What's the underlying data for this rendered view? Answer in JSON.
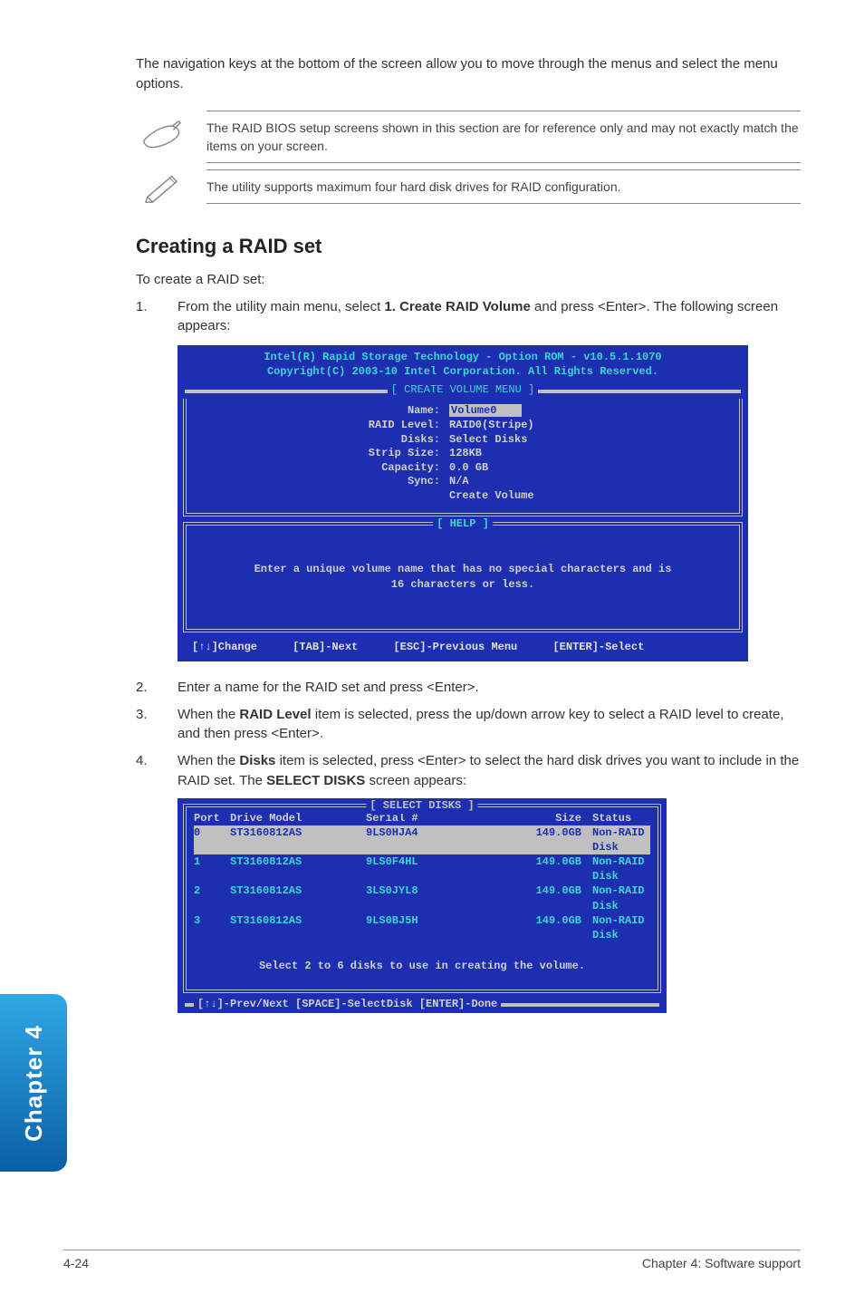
{
  "intro": "The navigation keys at the bottom of the screen allow you to move through the menus and select the menu options.",
  "note1": "The RAID BIOS setup screens shown in this section are for reference only and may not exactly match the items on your screen.",
  "note2": "The utility supports maximum four hard disk drives for RAID configuration.",
  "heading": "Creating a RAID set",
  "sub": "To create a RAID set:",
  "steps": {
    "s1a": "From the utility main menu, select ",
    "s1b": "1. Create RAID Volume",
    "s1c": " and press <Enter>. The following screen appears:",
    "s2": "Enter a name for the RAID set and press <Enter>.",
    "s3a": "When the ",
    "s3b": "RAID Level",
    "s3c": " item is selected, press the up/down arrow key to select a RAID level to create, and then press <Enter>.",
    "s4a": "When the ",
    "s4b": "Disks",
    "s4c": " item is selected, press <Enter> to select the hard disk drives you want to include in the RAID set. The ",
    "s4d": "SELECT DISKS",
    "s4e": " screen appears:"
  },
  "bios": {
    "hdr1": "Intel(R) Rapid Storage Technology - Option ROM - v10.5.1.1070",
    "hdr2": "Copyright(C) 2003-10 Intel Corporation.  All Rights Reserved.",
    "menu_title": "[ CREATE VOLUME MENU ]",
    "fields": {
      "name_l": "Name:",
      "name_v": "Volume0",
      "raid_l": "RAID Level:",
      "raid_v": "RAID0(Stripe)",
      "disks_l": "Disks:",
      "disks_v": "Select Disks",
      "strip_l": "Strip Size:",
      "strip_v": "128KB",
      "cap_l": "Capacity:",
      "cap_v": "0.0   GB",
      "sync_l": "Sync:",
      "sync_v": "N/A",
      "create_v": "Create Volume"
    },
    "help_title": "[ HELP ]",
    "help_l1": "Enter a unique volume name that has no special characters and is",
    "help_l2": "16 characters or less.",
    "nav": {
      "a": "[↑↓]Change",
      "b": "[TAB]-Next",
      "c": "[ESC]-Previous Menu",
      "d": "[ENTER]-Select"
    }
  },
  "disks": {
    "title": "[ SELECT DISKS ]",
    "head": {
      "port": "Port",
      "model": "Drive Model",
      "serial": "Serial #",
      "size": "Size",
      "status": "Status"
    },
    "rows": [
      {
        "port": "0",
        "model": "ST3160812AS",
        "serial": "9LS0HJA4",
        "size": "149.0GB",
        "status": "Non-RAID Disk"
      },
      {
        "port": "1",
        "model": "ST3160812AS",
        "serial": "9LS0F4HL",
        "size": "149.0GB",
        "status": "Non-RAID Disk"
      },
      {
        "port": "2",
        "model": "ST3160812AS",
        "serial": "3LS0JYL8",
        "size": "149.0GB",
        "status": "Non-RAID Disk"
      },
      {
        "port": "3",
        "model": "ST3160812AS",
        "serial": "9LS0BJ5H",
        "size": "149.0GB",
        "status": "Non-RAID Disk"
      }
    ],
    "msg": "Select 2 to 6 disks to use in creating the volume.",
    "foot": "[↑↓]-Prev/Next [SPACE]-SelectDisk [ENTER]-Done"
  },
  "side": "Chapter 4",
  "foot_left": "4-24",
  "foot_right": "Chapter 4: Software support"
}
